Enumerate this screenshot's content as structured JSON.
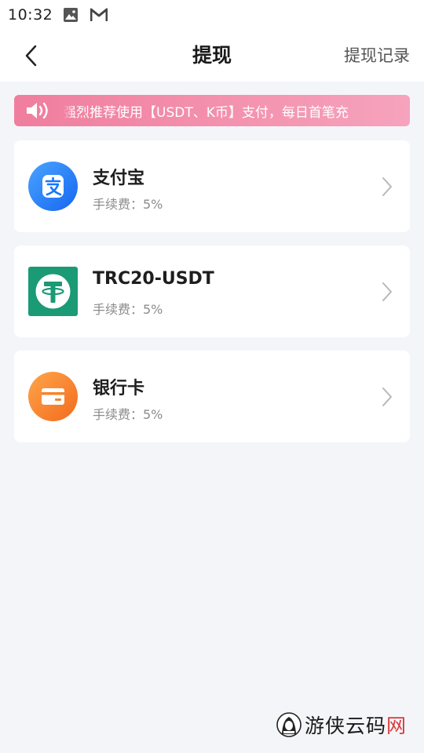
{
  "status_bar": {
    "time": "10:32",
    "icons": [
      "image-icon",
      "gmail-icon"
    ]
  },
  "header": {
    "back_icon": "chevron-left-icon",
    "title": "提现",
    "record_link": "提现记录"
  },
  "notice": {
    "icon": "speaker-icon",
    "text": "强烈推荐使用【USDT、K币】支付，每日首笔充",
    "colors": {
      "start": "#f07d9d",
      "end": "#f6a3bd"
    }
  },
  "methods": [
    {
      "name": "支付宝",
      "fee": "手续费：5%",
      "icon": "alipay-icon",
      "color": "#1677ff"
    },
    {
      "name": "TRC20-USDT",
      "fee": "手续费：5%",
      "icon": "tether-icon",
      "color": "#1a9a75"
    },
    {
      "name": "银行卡",
      "fee": "手续费：5%",
      "icon": "bank-card-icon",
      "color": "#f57f2a"
    }
  ],
  "watermark": {
    "text_main": "游侠云码",
    "text_accent": "网",
    "logo": "hooded-figure-logo"
  }
}
